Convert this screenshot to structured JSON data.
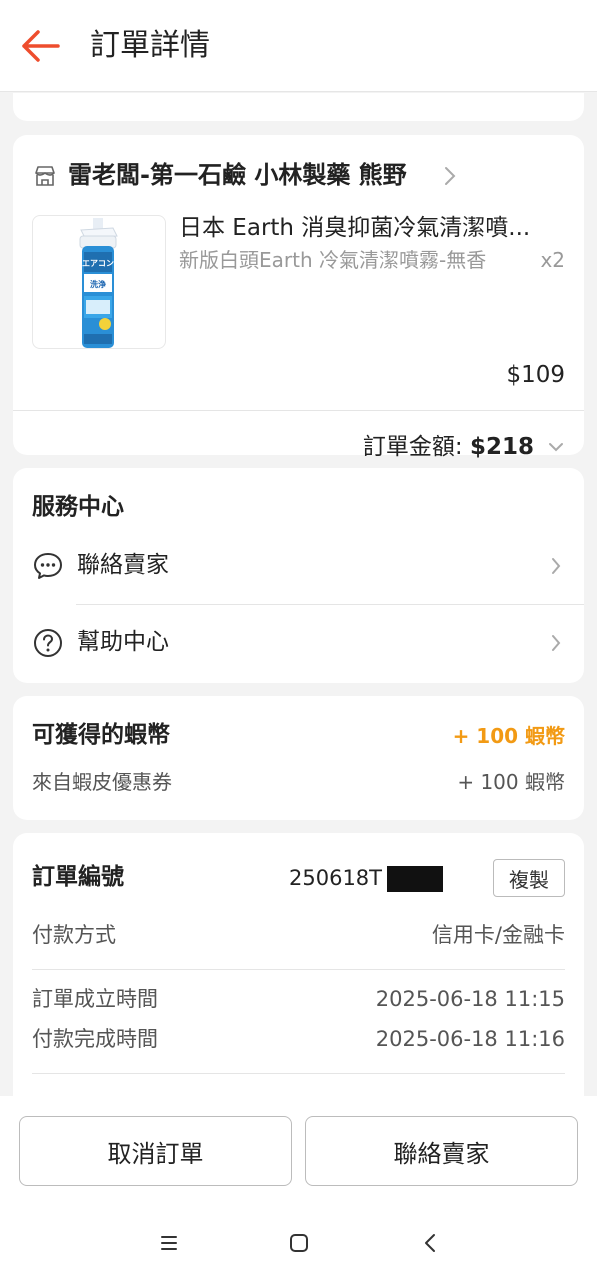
{
  "header": {
    "title": "訂單詳情"
  },
  "shop": {
    "name": "雷老闆-第一石鹼 小林製藥 熊野",
    "product": {
      "name": "日本 Earth 消臭抑菌冷氣清潔噴...",
      "variant": "新版白頭Earth 冷氣清潔噴霧-無香",
      "quantity": "x2",
      "price": "$109",
      "image_text": "エアコン洗浄スプレー"
    },
    "total_label": "訂單金額: ",
    "total_value": "$218"
  },
  "service_center": {
    "title": "服務中心",
    "items": [
      {
        "label": "聯絡賣家",
        "icon": "chat-bubble-icon"
      },
      {
        "label": "幫助中心",
        "icon": "help-circle-icon"
      }
    ]
  },
  "coins": {
    "title": "可獲得的蝦幣",
    "amount": "+ 100 蝦幣",
    "source_label": "來自蝦皮優惠券",
    "source_amount": "+ 100 蝦幣"
  },
  "order_info": {
    "order_no_label": "訂單編號",
    "order_no_value": "250618T",
    "copy_label": "複製",
    "payment_label": "付款方式",
    "payment_value": "信用卡/金融卡",
    "created_label": "訂單成立時間",
    "created_value": "2025-06-18 11:15",
    "paid_label": "付款完成時間",
    "paid_value": "2025-06-18 11:16"
  },
  "actions": {
    "cancel_label": "取消訂單",
    "contact_label": "聯絡賣家"
  },
  "colors": {
    "accent": "#ee4d2d",
    "coins": "#f29a14"
  }
}
